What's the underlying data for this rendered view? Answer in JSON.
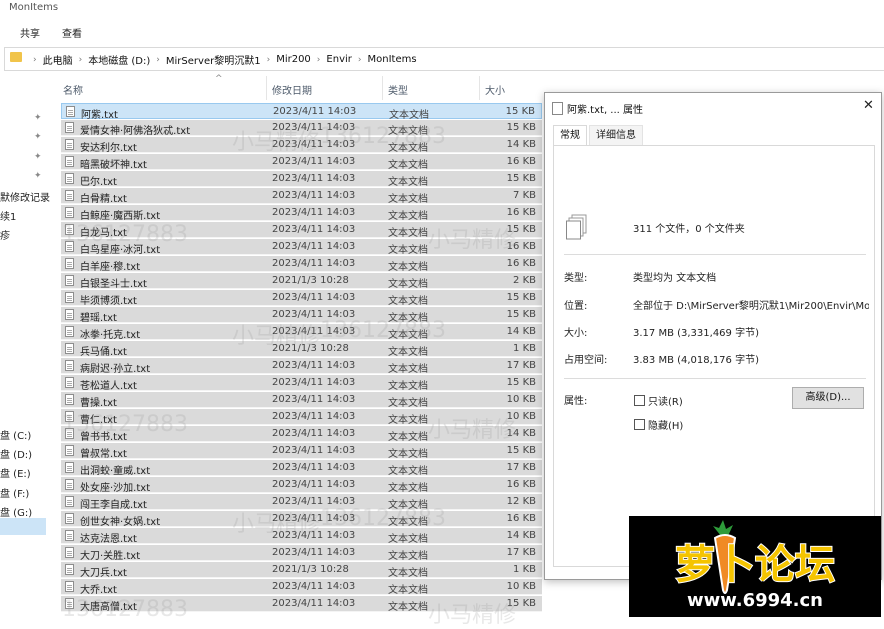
{
  "window": {
    "title": "MonItems"
  },
  "ribbon": {
    "tabs": [
      "共享",
      "查看"
    ]
  },
  "address": {
    "crumbs": [
      "此电脑",
      "本地磁盘 (D:)",
      "MirServer黎明沉默1",
      "Mir200",
      "Envir",
      "MonItems"
    ]
  },
  "nav": {
    "partial_labels": [
      "默修改记录",
      "续1",
      "疹"
    ],
    "drives": [
      "盘 (C:)",
      "盘 (D:)",
      "盘 (E:)",
      "盘 (F:)",
      "盘 (G:)"
    ]
  },
  "columns": {
    "name": "名称",
    "date": "修改日期",
    "type": "类型",
    "size": "大小"
  },
  "files": [
    {
      "name": "阿紫.txt",
      "date": "2023/4/11 14:03",
      "type": "文本文档",
      "size": "15 KB"
    },
    {
      "name": "爱情女神·阿佛洛狄忒.txt",
      "date": "2023/4/11 14:03",
      "type": "文本文档",
      "size": "15 KB"
    },
    {
      "name": "安达利尔.txt",
      "date": "2023/4/11 14:03",
      "type": "文本文档",
      "size": "14 KB"
    },
    {
      "name": "暗黑破坏神.txt",
      "date": "2023/4/11 14:03",
      "type": "文本文档",
      "size": "16 KB"
    },
    {
      "name": "巴尔.txt",
      "date": "2023/4/11 14:03",
      "type": "文本文档",
      "size": "15 KB"
    },
    {
      "name": "白骨精.txt",
      "date": "2023/4/11 14:03",
      "type": "文本文档",
      "size": "7 KB"
    },
    {
      "name": "白鲸座·魔西斯.txt",
      "date": "2023/4/11 14:03",
      "type": "文本文档",
      "size": "16 KB"
    },
    {
      "name": "白龙马.txt",
      "date": "2023/4/11 14:03",
      "type": "文本文档",
      "size": "15 KB"
    },
    {
      "name": "白鸟星座·冰河.txt",
      "date": "2023/4/11 14:03",
      "type": "文本文档",
      "size": "16 KB"
    },
    {
      "name": "白羊座·穆.txt",
      "date": "2023/4/11 14:03",
      "type": "文本文档",
      "size": "16 KB"
    },
    {
      "name": "白银圣斗士.txt",
      "date": "2021/1/3 10:28",
      "type": "文本文档",
      "size": "2 KB"
    },
    {
      "name": "毕须博须.txt",
      "date": "2023/4/11 14:03",
      "type": "文本文档",
      "size": "15 KB"
    },
    {
      "name": "碧瑶.txt",
      "date": "2023/4/11 14:03",
      "type": "文本文档",
      "size": "15 KB"
    },
    {
      "name": "冰拳·托克.txt",
      "date": "2023/4/11 14:03",
      "type": "文本文档",
      "size": "14 KB"
    },
    {
      "name": "兵马俑.txt",
      "date": "2021/1/3 10:28",
      "type": "文本文档",
      "size": "1 KB"
    },
    {
      "name": "病尉迟·孙立.txt",
      "date": "2023/4/11 14:03",
      "type": "文本文档",
      "size": "17 KB"
    },
    {
      "name": "苍松道人.txt",
      "date": "2023/4/11 14:03",
      "type": "文本文档",
      "size": "15 KB"
    },
    {
      "name": "曹操.txt",
      "date": "2023/4/11 14:03",
      "type": "文本文档",
      "size": "10 KB"
    },
    {
      "name": "曹仁.txt",
      "date": "2023/4/11 14:03",
      "type": "文本文档",
      "size": "10 KB"
    },
    {
      "name": "曾书书.txt",
      "date": "2023/4/11 14:03",
      "type": "文本文档",
      "size": "14 KB"
    },
    {
      "name": "曾叔常.txt",
      "date": "2023/4/11 14:03",
      "type": "文本文档",
      "size": "15 KB"
    },
    {
      "name": "出洞蛟·童威.txt",
      "date": "2023/4/11 14:03",
      "type": "文本文档",
      "size": "17 KB"
    },
    {
      "name": "处女座·沙加.txt",
      "date": "2023/4/11 14:03",
      "type": "文本文档",
      "size": "16 KB"
    },
    {
      "name": "闯王李自成.txt",
      "date": "2023/4/11 14:03",
      "type": "文本文档",
      "size": "12 KB"
    },
    {
      "name": "创世女神·女娲.txt",
      "date": "2023/4/11 14:03",
      "type": "文本文档",
      "size": "16 KB"
    },
    {
      "name": "达克法恩.txt",
      "date": "2023/4/11 14:03",
      "type": "文本文档",
      "size": "14 KB"
    },
    {
      "name": "大刀·关胜.txt",
      "date": "2023/4/11 14:03",
      "type": "文本文档",
      "size": "17 KB"
    },
    {
      "name": "大刀兵.txt",
      "date": "2021/1/3 10:28",
      "type": "文本文档",
      "size": "1 KB"
    },
    {
      "name": "大乔.txt",
      "date": "2023/4/11 14:03",
      "type": "文本文档",
      "size": "10 KB"
    },
    {
      "name": "大唐高僧.txt",
      "date": "2023/4/11 14:03",
      "type": "文本文档",
      "size": "15 KB"
    }
  ],
  "watermark": {
    "text_a": "小马精修",
    "text_b": "136127883"
  },
  "dialog": {
    "title": "阿紫.txt, ... 属性",
    "tabs": [
      "常规",
      "详细信息"
    ],
    "summary": "311 个文件，0 个文件夹",
    "fields": [
      {
        "label": "类型:",
        "value": "类型均为 文本文档"
      },
      {
        "label": "位置:",
        "value": "全部位于 D:\\MirServer黎明沉默1\\Mir200\\Envir\\Mo"
      },
      {
        "label": "大小:",
        "value": "3.17 MB (3,331,469 字节)"
      },
      {
        "label": "占用空间:",
        "value": "3.83 MB (4,018,176 字节)"
      }
    ],
    "attributes_label": "属性:",
    "readonly_label": "只读(R)",
    "hidden_label": "隐藏(H)",
    "advanced_button": "高级(D)..."
  },
  "logo": {
    "title": "萝卜论坛",
    "url": "www.6994.cn",
    "brand_color": "#f5c400"
  }
}
